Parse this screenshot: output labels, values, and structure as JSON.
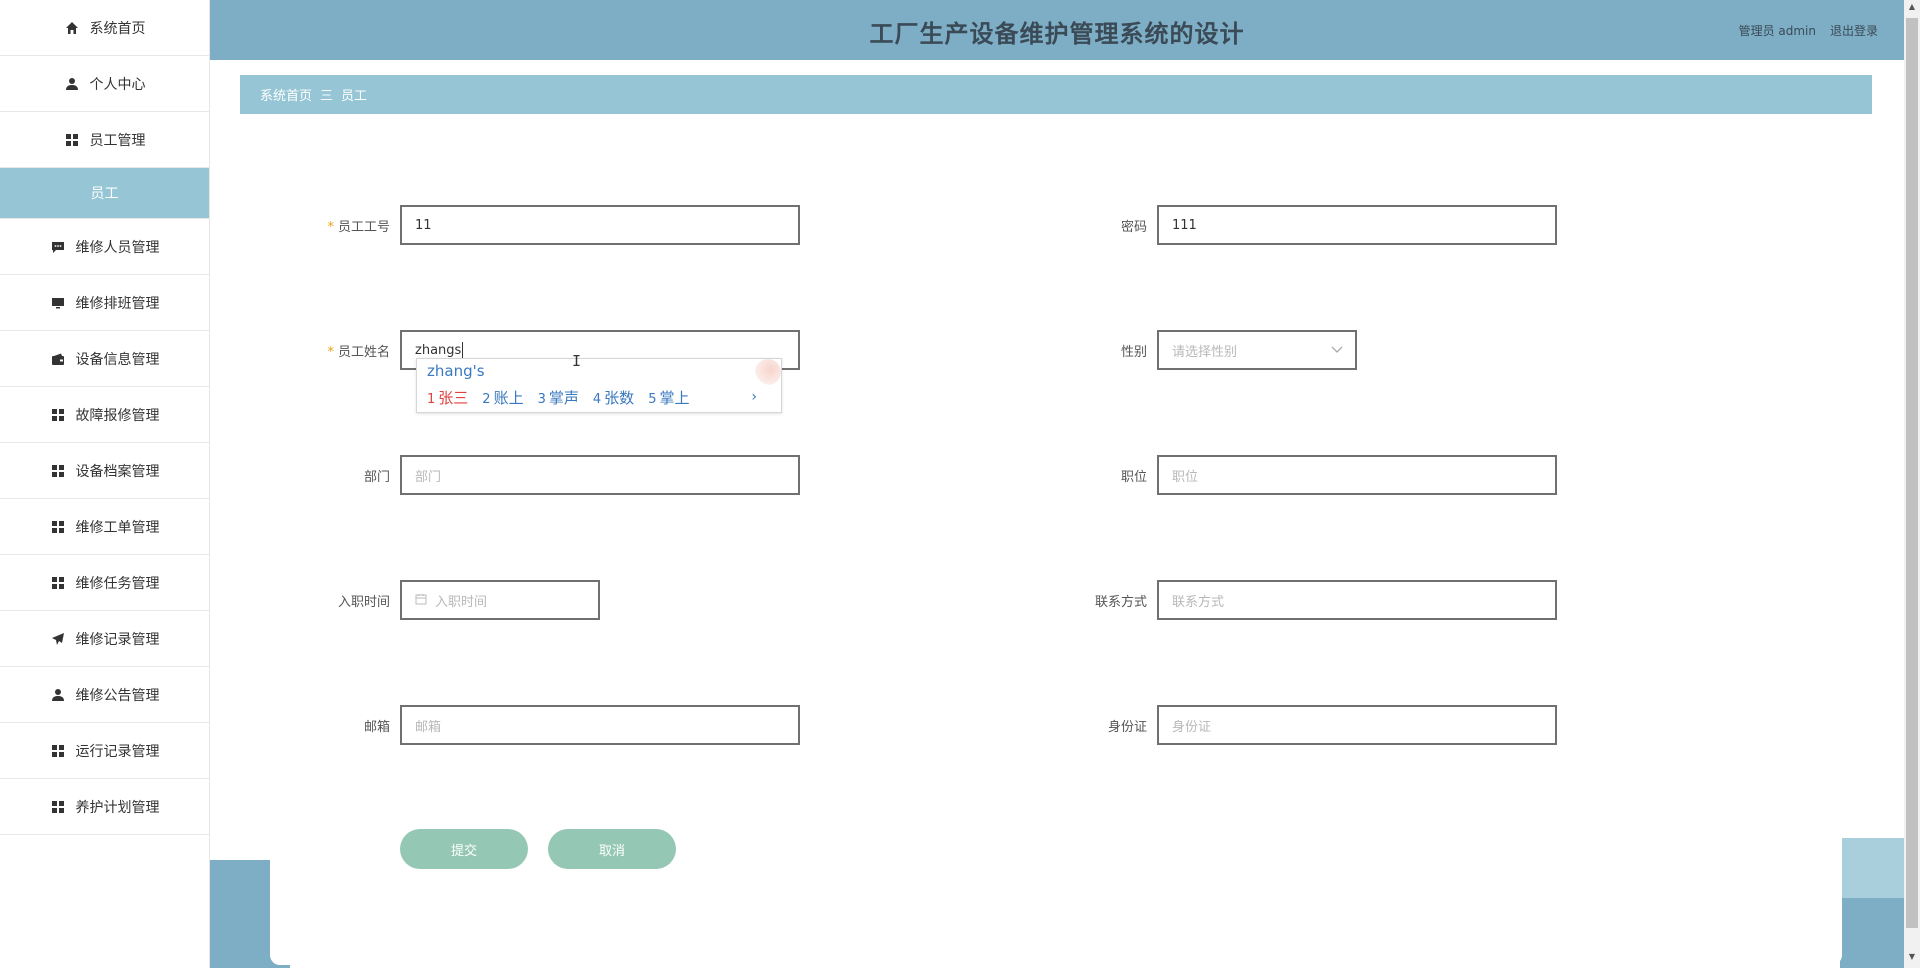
{
  "app": {
    "title": "工厂生产设备维护管理系统的设计",
    "user_label": "管理员 admin",
    "logout_label": "退出登录"
  },
  "colors": {
    "header_bg": "#7eaec5",
    "breadcrumb_bg": "#96c6d6",
    "button_bg": "#95c8b4",
    "required_star": "#e8a317"
  },
  "sidebar": {
    "items": [
      {
        "label": "系统首页",
        "icon": "home-icon"
      },
      {
        "label": "个人中心",
        "icon": "person-icon"
      },
      {
        "label": "员工管理",
        "icon": "grid-icon"
      },
      {
        "label": "员工",
        "icon": ""
      },
      {
        "label": "维修人员管理",
        "icon": "chat-icon"
      },
      {
        "label": "维修排班管理",
        "icon": "monitor-icon"
      },
      {
        "label": "设备信息管理",
        "icon": "wallet-icon"
      },
      {
        "label": "故障报修管理",
        "icon": "grid-icon"
      },
      {
        "label": "设备档案管理",
        "icon": "grid-icon"
      },
      {
        "label": "维修工单管理",
        "icon": "grid-icon"
      },
      {
        "label": "维修任务管理",
        "icon": "grid-icon"
      },
      {
        "label": "维修记录管理",
        "icon": "send-icon"
      },
      {
        "label": "维修公告管理",
        "icon": "person-icon"
      },
      {
        "label": "运行记录管理",
        "icon": "grid-icon"
      },
      {
        "label": "养护计划管理",
        "icon": "grid-icon"
      }
    ]
  },
  "breadcrumb": {
    "home": "系统首页",
    "separator": "三",
    "current": "员工"
  },
  "form": {
    "employee_no": {
      "label": "员工工号",
      "value": "11",
      "required": true
    },
    "password": {
      "label": "密码",
      "value": "111"
    },
    "employee_name": {
      "label": "员工姓名",
      "value": "zhangs",
      "required": true
    },
    "gender": {
      "label": "性别",
      "placeholder": "请选择性别"
    },
    "department": {
      "label": "部门",
      "placeholder": "部门"
    },
    "position": {
      "label": "职位",
      "placeholder": "职位"
    },
    "hire_date": {
      "label": "入职时间",
      "placeholder": "入职时间"
    },
    "contact": {
      "label": "联系方式",
      "placeholder": "联系方式"
    },
    "email": {
      "label": "邮箱",
      "placeholder": "邮箱"
    },
    "id_card": {
      "label": "身份证",
      "placeholder": "身份证"
    },
    "submit_label": "提交",
    "cancel_label": "取消"
  },
  "ime": {
    "composition": "zhang's",
    "candidates": [
      {
        "num": "1",
        "text": "张三"
      },
      {
        "num": "2",
        "text": "账上"
      },
      {
        "num": "3",
        "text": "掌声"
      },
      {
        "num": "4",
        "text": "张数"
      },
      {
        "num": "5",
        "text": "掌上"
      }
    ],
    "next_label": "›"
  }
}
